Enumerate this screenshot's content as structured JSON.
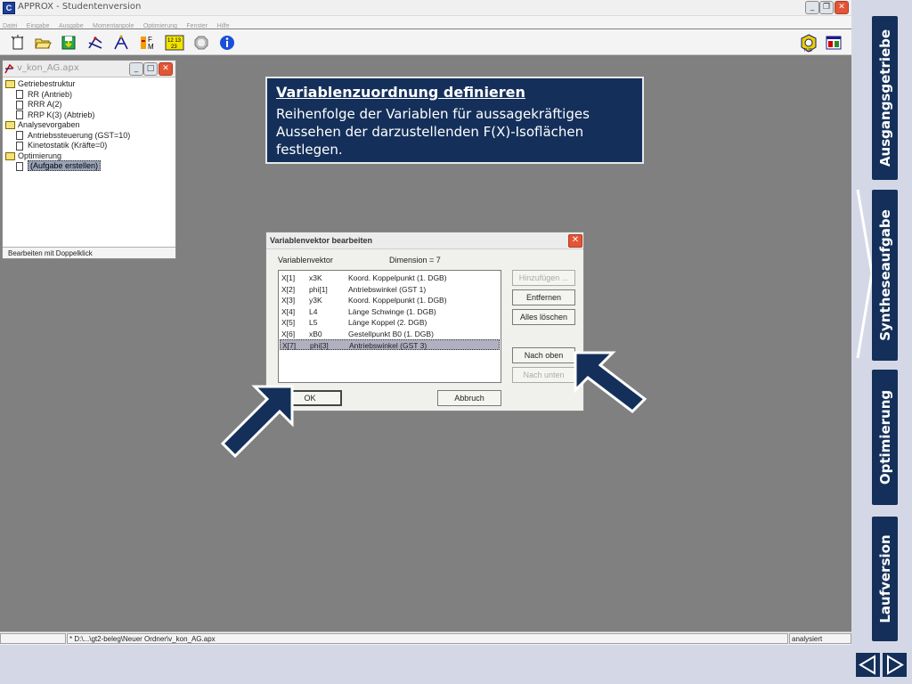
{
  "app": {
    "title": "APPROX - Studentenversion",
    "menu": [
      "Datei",
      "Eingabe",
      "Ausgabe",
      "Momentanpole",
      "Optimierung",
      "Fenster",
      "Hilfe"
    ]
  },
  "toolbar": {
    "icons": [
      "new-document-icon",
      "open-folder-icon",
      "save-icon",
      "mechanism-icon",
      "linkage-icon",
      "force-icon",
      "matrix-icon",
      "stop-icon",
      "info-icon",
      "optimus-tud-icon",
      "window-icon"
    ],
    "matrix_label": "12 13 23"
  },
  "project": {
    "title": "v_kon_AG.apx",
    "tree": [
      {
        "label": "Getriebestruktur",
        "type": "folder"
      },
      {
        "label": "RR (Antrieb)",
        "type": "doc"
      },
      {
        "label": "RRR A(2)",
        "type": "doc"
      },
      {
        "label": "RRP K(3) (Abtrieb)",
        "type": "doc"
      },
      {
        "label": "Analysevorgaben",
        "type": "folder"
      },
      {
        "label": "Antriebssteuerung (GST=10)",
        "type": "doc"
      },
      {
        "label": "Kinetostatik (Kräfte=0)",
        "type": "doc"
      },
      {
        "label": "Optimierung",
        "type": "folder"
      },
      {
        "label": "(Aufgabe erstellen)",
        "type": "doc",
        "selected": true
      }
    ],
    "status": "Bearbeiten mit Doppelklick"
  },
  "info": {
    "heading": "Variablenzuordnung definieren",
    "body": "Reihenfolge der Variablen für aussagekräftiges Aussehen der darzustellenden F(X)-Isoflächen festlegen."
  },
  "dialog": {
    "title": "Variablenvektor bearbeiten",
    "list_label": "Variablenvektor",
    "dimension": "Dimension =  7",
    "rows": [
      [
        "X[1]",
        "x3K",
        "Koord. Koppelpunkt (1. DGB)"
      ],
      [
        "X[2]",
        "phi[1]",
        "Antriebswinkel (GST 1)"
      ],
      [
        "X[3]",
        "y3K",
        "Koord. Koppelpunkt (1. DGB)"
      ],
      [
        "X[4]",
        "L4",
        "Länge Schwinge (1. DGB)"
      ],
      [
        "X[5]",
        "L5",
        "Länge Koppel (2. DGB)"
      ],
      [
        "X[6]",
        "xB0",
        "Gestellpunkt B0 (1. DGB)"
      ],
      [
        "X[7]",
        "phi[3]",
        "Antriebswinkel (GST 3)"
      ]
    ],
    "selected_row": 6,
    "buttons": {
      "add": "Hinzufügen ...",
      "remove": "Entfernen",
      "clear": "Alles löschen",
      "up": "Nach oben",
      "down": "Nach unten",
      "ok": "OK",
      "cancel": "Abbruch"
    }
  },
  "statusbar": {
    "path": "* D:\\...\\gt2-beleg\\Neuer Ordner\\v_kon_AG.apx",
    "state": "analysiert"
  },
  "nav": {
    "tabs": [
      "Ausgangsgetriebe",
      "Syntheseaufgabe",
      "Optimierung",
      "Laufversion"
    ],
    "active": "Syntheseaufgabe",
    "prev_icon": "triangle-left-icon",
    "next_icon": "triangle-right-icon"
  },
  "colors": {
    "accent": "#14305a",
    "workspace": "#808080",
    "close": "#e25535"
  }
}
